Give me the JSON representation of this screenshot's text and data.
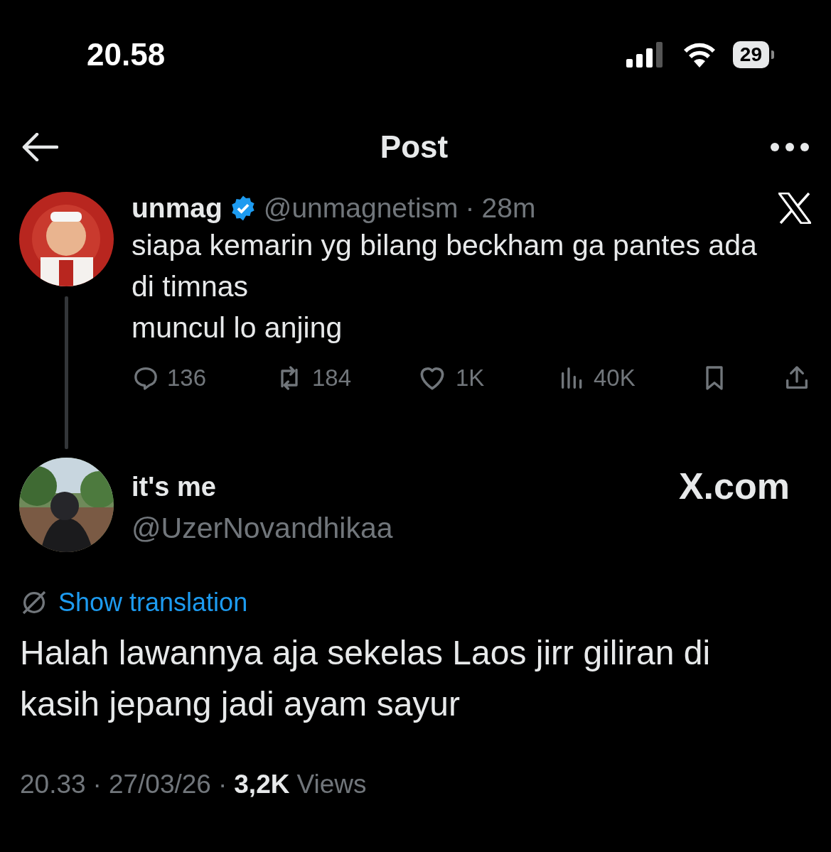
{
  "status_bar": {
    "time": "20.58",
    "battery": "29"
  },
  "header": {
    "title": "Post"
  },
  "parent_post": {
    "name": "unmag",
    "verified": true,
    "handle": "@unmagnetism",
    "separator": "·",
    "time": "28m",
    "lines": [
      "siapa kemarin yg bilang beckham ga pantes ada",
      "di timnas",
      "muncul lo anjing"
    ],
    "stats": {
      "replies": "136",
      "reposts": "184",
      "likes": "1K",
      "views": "40K"
    }
  },
  "reply": {
    "name": "it's me",
    "handle": "@UzerNovandhikaa",
    "brand": "X.com",
    "translate": "Show translation",
    "lines": [
      "Halah lawannya aja sekelas Laos jirr giliran di",
      "kasih jepang jadi ayam sayur"
    ],
    "footer": {
      "time": "20.33",
      "separator_1": "·",
      "date": "27/03/26",
      "separator_2": "·",
      "views_count": "3,2K",
      "views_label": "Views"
    }
  }
}
